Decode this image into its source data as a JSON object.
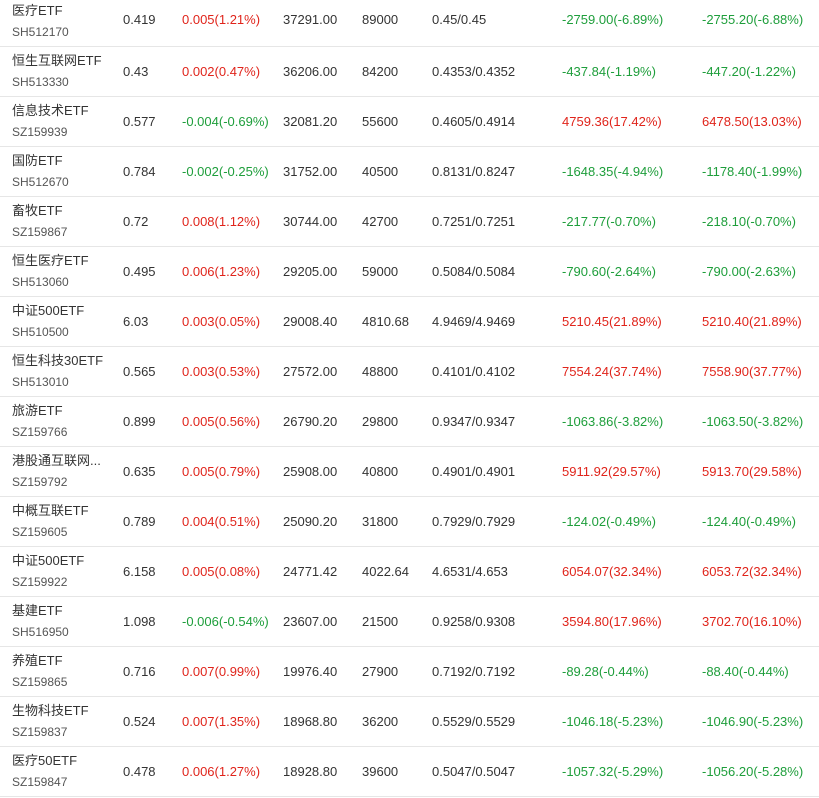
{
  "colors": {
    "up": "#e0241b",
    "down": "#1e9e3b",
    "text": "#333333",
    "divider": "#e6e6e6"
  },
  "rows": [
    {
      "name": "医疗ETF",
      "code": "SH512170",
      "price": "0.419",
      "change": "0.005(1.21%)",
      "change_dir": "up",
      "amount": "37291.00",
      "volume": "89000",
      "bid_ask": "0.45/0.45",
      "flow1": "-2759.00(-6.89%)",
      "flow1_dir": "down",
      "flow2": "-2755.20(-6.88%)",
      "flow2_dir": "down"
    },
    {
      "name": "恒生互联网ETF",
      "code": "SH513330",
      "price": "0.43",
      "change": "0.002(0.47%)",
      "change_dir": "up",
      "amount": "36206.00",
      "volume": "84200",
      "bid_ask": "0.4353/0.4352",
      "flow1": "-437.84(-1.19%)",
      "flow1_dir": "down",
      "flow2": "-447.20(-1.22%)",
      "flow2_dir": "down"
    },
    {
      "name": "信息技术ETF",
      "code": "SZ159939",
      "price": "0.577",
      "change": "-0.004(-0.69%)",
      "change_dir": "down",
      "amount": "32081.20",
      "volume": "55600",
      "bid_ask": "0.4605/0.4914",
      "flow1": "4759.36(17.42%)",
      "flow1_dir": "up",
      "flow2": "6478.50(13.03%)",
      "flow2_dir": "up"
    },
    {
      "name": "国防ETF",
      "code": "SH512670",
      "price": "0.784",
      "change": "-0.002(-0.25%)",
      "change_dir": "down",
      "amount": "31752.00",
      "volume": "40500",
      "bid_ask": "0.8131/0.8247",
      "flow1": "-1648.35(-4.94%)",
      "flow1_dir": "down",
      "flow2": "-1178.40(-1.99%)",
      "flow2_dir": "down"
    },
    {
      "name": "畜牧ETF",
      "code": "SZ159867",
      "price": "0.72",
      "change": "0.008(1.12%)",
      "change_dir": "up",
      "amount": "30744.00",
      "volume": "42700",
      "bid_ask": "0.7251/0.7251",
      "flow1": "-217.77(-0.70%)",
      "flow1_dir": "down",
      "flow2": "-218.10(-0.70%)",
      "flow2_dir": "down"
    },
    {
      "name": "恒生医疗ETF",
      "code": "SH513060",
      "price": "0.495",
      "change": "0.006(1.23%)",
      "change_dir": "up",
      "amount": "29205.00",
      "volume": "59000",
      "bid_ask": "0.5084/0.5084",
      "flow1": "-790.60(-2.64%)",
      "flow1_dir": "down",
      "flow2": "-790.00(-2.63%)",
      "flow2_dir": "down"
    },
    {
      "name": "中证500ETF",
      "code": "SH510500",
      "price": "6.03",
      "change": "0.003(0.05%)",
      "change_dir": "up",
      "amount": "29008.40",
      "volume": "4810.68",
      "bid_ask": "4.9469/4.9469",
      "flow1": "5210.45(21.89%)",
      "flow1_dir": "up",
      "flow2": "5210.40(21.89%)",
      "flow2_dir": "up"
    },
    {
      "name": "恒生科技30ETF",
      "code": "SH513010",
      "price": "0.565",
      "change": "0.003(0.53%)",
      "change_dir": "up",
      "amount": "27572.00",
      "volume": "48800",
      "bid_ask": "0.4101/0.4102",
      "flow1": "7554.24(37.74%)",
      "flow1_dir": "up",
      "flow2": "7558.90(37.77%)",
      "flow2_dir": "up"
    },
    {
      "name": "旅游ETF",
      "code": "SZ159766",
      "price": "0.899",
      "change": "0.005(0.56%)",
      "change_dir": "up",
      "amount": "26790.20",
      "volume": "29800",
      "bid_ask": "0.9347/0.9347",
      "flow1": "-1063.86(-3.82%)",
      "flow1_dir": "down",
      "flow2": "-1063.50(-3.82%)",
      "flow2_dir": "down"
    },
    {
      "name": "港股通互联网...",
      "code": "SZ159792",
      "price": "0.635",
      "change": "0.005(0.79%)",
      "change_dir": "up",
      "amount": "25908.00",
      "volume": "40800",
      "bid_ask": "0.4901/0.4901",
      "flow1": "5911.92(29.57%)",
      "flow1_dir": "up",
      "flow2": "5913.70(29.58%)",
      "flow2_dir": "up"
    },
    {
      "name": "中概互联ETF",
      "code": "SZ159605",
      "price": "0.789",
      "change": "0.004(0.51%)",
      "change_dir": "up",
      "amount": "25090.20",
      "volume": "31800",
      "bid_ask": "0.7929/0.7929",
      "flow1": "-124.02(-0.49%)",
      "flow1_dir": "down",
      "flow2": "-124.40(-0.49%)",
      "flow2_dir": "down"
    },
    {
      "name": "中证500ETF",
      "code": "SZ159922",
      "price": "6.158",
      "change": "0.005(0.08%)",
      "change_dir": "up",
      "amount": "24771.42",
      "volume": "4022.64",
      "bid_ask": "4.6531/4.653",
      "flow1": "6054.07(32.34%)",
      "flow1_dir": "up",
      "flow2": "6053.72(32.34%)",
      "flow2_dir": "up"
    },
    {
      "name": "基建ETF",
      "code": "SH516950",
      "price": "1.098",
      "change": "-0.006(-0.54%)",
      "change_dir": "down",
      "amount": "23607.00",
      "volume": "21500",
      "bid_ask": "0.9258/0.9308",
      "flow1": "3594.80(17.96%)",
      "flow1_dir": "up",
      "flow2": "3702.70(16.10%)",
      "flow2_dir": "up"
    },
    {
      "name": "养殖ETF",
      "code": "SZ159865",
      "price": "0.716",
      "change": "0.007(0.99%)",
      "change_dir": "up",
      "amount": "19976.40",
      "volume": "27900",
      "bid_ask": "0.7192/0.7192",
      "flow1": "-89.28(-0.44%)",
      "flow1_dir": "down",
      "flow2": "-88.40(-0.44%)",
      "flow2_dir": "down"
    },
    {
      "name": "生物科技ETF",
      "code": "SZ159837",
      "price": "0.524",
      "change": "0.007(1.35%)",
      "change_dir": "up",
      "amount": "18968.80",
      "volume": "36200",
      "bid_ask": "0.5529/0.5529",
      "flow1": "-1046.18(-5.23%)",
      "flow1_dir": "down",
      "flow2": "-1046.90(-5.23%)",
      "flow2_dir": "down"
    },
    {
      "name": "医疗50ETF",
      "code": "SZ159847",
      "price": "0.478",
      "change": "0.006(1.27%)",
      "change_dir": "up",
      "amount": "18928.80",
      "volume": "39600",
      "bid_ask": "0.5047/0.5047",
      "flow1": "-1057.32(-5.29%)",
      "flow1_dir": "down",
      "flow2": "-1056.20(-5.28%)",
      "flow2_dir": "down"
    }
  ]
}
